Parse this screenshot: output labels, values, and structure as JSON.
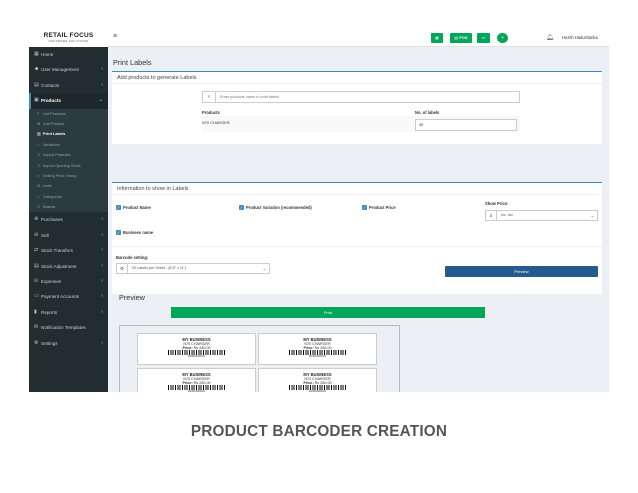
{
  "brand": {
    "name": "RETAIL FOCUS",
    "tagline": "SOFTWARE SOLUTIONS"
  },
  "sidebar": {
    "items": [
      {
        "label": "Home",
        "icon": "dashboard-icon"
      },
      {
        "label": "User Management",
        "icon": "users-icon"
      },
      {
        "label": "Contacts",
        "icon": "address-book-icon"
      },
      {
        "label": "Products",
        "icon": "cubes-icon"
      },
      {
        "label": "Purchases",
        "icon": "purchase-icon"
      },
      {
        "label": "Sell",
        "icon": "sell-icon"
      },
      {
        "label": "Stock Transfers",
        "icon": "truck-icon"
      },
      {
        "label": "Stock Adjustment",
        "icon": "database-icon"
      },
      {
        "label": "Expenses",
        "icon": "minus-circle-icon"
      },
      {
        "label": "Payment Accounts",
        "icon": "money-icon"
      },
      {
        "label": "Reports",
        "icon": "chart-icon"
      },
      {
        "label": "Notification Templates",
        "icon": "envelope-icon"
      },
      {
        "label": "Settings",
        "icon": "cog-icon"
      }
    ],
    "products_sub": [
      "List Products",
      "Add Product",
      "Print Labels",
      "Variations",
      "Import Products",
      "Import Opening Stock",
      "Selling Price Group",
      "Units",
      "Categories",
      "Brands"
    ]
  },
  "header": {
    "pos_label": "POS",
    "user_name": "Hezith Hadushanka"
  },
  "page": {
    "title": "Print Labels"
  },
  "add_products": {
    "title": "Add products to generate Labels",
    "search_placeholder": "Enter products name to print labels",
    "col_products": "Products",
    "col_labels": "No. of labels",
    "row_product": "N70 CHARGER",
    "row_labels": "30"
  },
  "info": {
    "title": "Information to show in Labels",
    "product_name": "Product Name",
    "product_variation": "Product Variation (recommended)",
    "product_price": "Product Price",
    "show_price_label": "Show Price:",
    "show_price_value": "Inc. tax",
    "business_name": "Business name",
    "barcode_setting_label": "Barcode setting:",
    "barcode_setting_value": "20 Labels per Sheet - (8.5\" x 11\")",
    "preview_button": "Preview"
  },
  "preview": {
    "title": "Preview",
    "print_button": "Print",
    "label_business": "MY BUSINESS",
    "label_product": "N70 CHARGER",
    "label_price_prefix": "Price:",
    "label_price": "Rs 280.00",
    "label_barcode_number": "0000000000001"
  },
  "caption": "PRODUCT BARCODER CREATION",
  "colors": {
    "sidebar": "#222d32",
    "accent": "#3c8dbc",
    "success": "#00a65a",
    "primary_btn": "#255a8f"
  }
}
